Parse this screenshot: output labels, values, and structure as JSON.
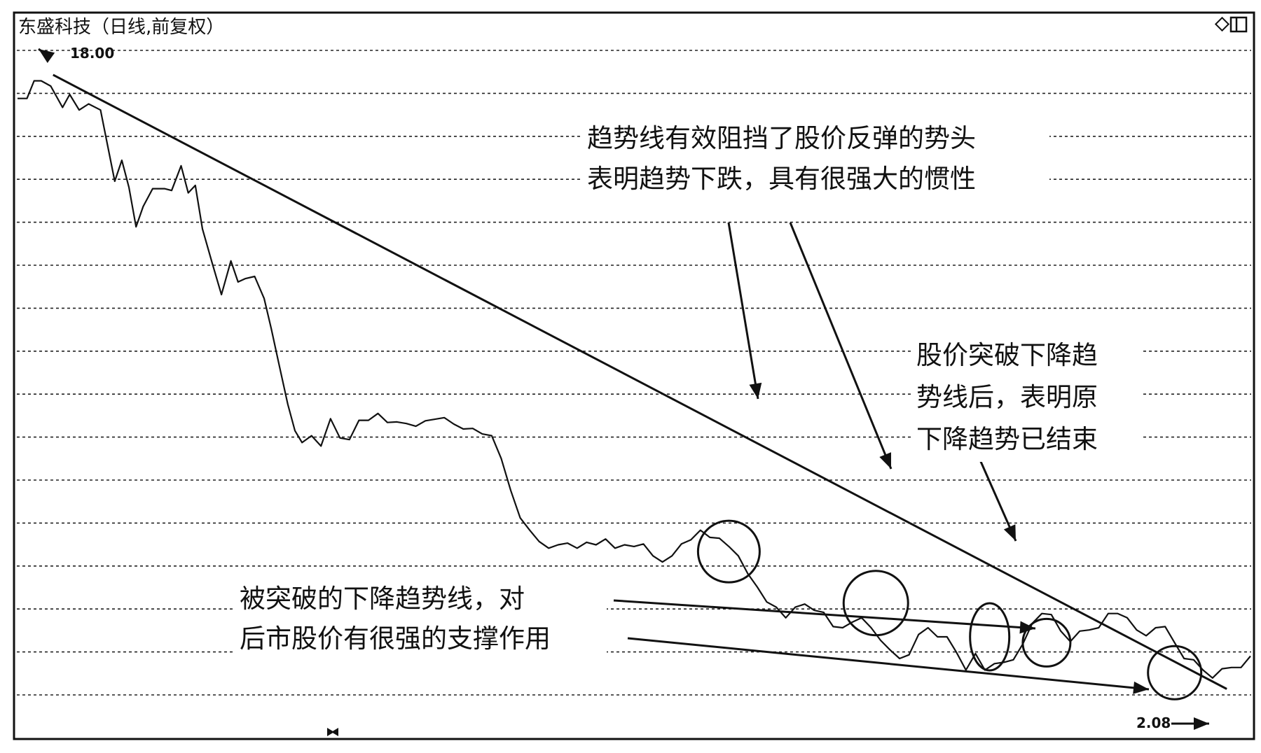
{
  "chart_data": {
    "type": "line",
    "title": "东盛科技（日线,前复权）",
    "price_high_label": "18.00",
    "price_low_label": "2.08",
    "toolbar_icons": [
      "diamond-icon",
      "panel-icon"
    ],
    "grid": true,
    "y_scale": "log",
    "ylim": [
      1.9,
      20.5
    ],
    "series": [
      {
        "x": [
          0,
          4,
          7,
          10,
          14,
          19,
          22,
          26,
          30,
          35,
          38,
          41,
          44,
          47,
          50,
          53,
          57,
          62,
          65,
          69,
          72,
          75,
          78,
          82,
          86,
          90,
          93,
          96,
          100,
          104,
          107,
          110,
          114,
          117,
          120,
          124,
          128,
          132,
          136,
          140,
          144,
          148,
          152,
          156,
          160,
          164,
          168,
          172,
          176,
          180,
          184,
          188,
          192,
          196,
          200,
          204,
          208,
          212,
          216,
          220,
          224,
          228,
          232,
          236,
          240,
          244,
          248,
          252,
          256,
          260,
          264,
          268,
          272,
          276,
          280,
          284,
          288,
          292,
          296,
          300,
          304,
          308,
          312,
          316,
          320,
          324,
          328,
          332,
          336,
          340,
          344,
          348,
          352,
          356,
          360,
          364,
          368,
          372,
          376,
          380,
          384,
          388,
          392,
          396,
          400,
          404,
          408,
          412,
          416,
          420,
          424,
          428,
          432,
          436,
          440,
          444,
          448,
          452,
          456,
          460,
          464,
          468,
          472,
          476,
          480,
          484,
          488,
          492,
          496,
          500,
          504,
          508,
          512,
          516,
          520
        ],
        "values": [
          16.54,
          16.54,
          17.62,
          17.62,
          17.29,
          16.02,
          16.78,
          15.87,
          16.22,
          15.87,
          13.98,
          12.3,
          13.26,
          12.03,
          10.45,
          11.24,
          11.98,
          11.98,
          11.9,
          13.0,
          11.8,
          12.12,
          10.37,
          9.21,
          8.2,
          9.25,
          8.58,
          8.68,
          8.75,
          8.09,
          7.26,
          6.46,
          5.54,
          5.04,
          4.83,
          4.95,
          4.77,
          5.26,
          4.91,
          4.88,
          5.23,
          5.23,
          5.36,
          5.19,
          5.2,
          5.17,
          5.12,
          5.22,
          5.25,
          5.28,
          5.16,
          5.07,
          5.08,
          4.98,
          4.95,
          4.56,
          4.07,
          3.69,
          3.53,
          3.39,
          3.31,
          3.35,
          3.37,
          3.31,
          3.38,
          3.35,
          3.42,
          3.31,
          3.35,
          3.33,
          3.36,
          3.22,
          3.15,
          3.22,
          3.36,
          3.41,
          3.53,
          3.44,
          3.43,
          3.33,
          3.22,
          3.02,
          2.88,
          2.73,
          2.68,
          2.58,
          2.68,
          2.71,
          2.65,
          2.63,
          2.5,
          2.49,
          2.54,
          2.58,
          2.49,
          2.38,
          2.3,
          2.23,
          2.26,
          2.43,
          2.49,
          2.41,
          2.41,
          2.28,
          2.14,
          2.27,
          2.14,
          2.19,
          2.2,
          2.22,
          2.35,
          2.53,
          2.62,
          2.61,
          2.46,
          2.37,
          2.46,
          2.47,
          2.49,
          2.62,
          2.62,
          2.58,
          2.47,
          2.42,
          2.49,
          2.5,
          2.36,
          2.23,
          2.22,
          2.14,
          2.08,
          2.15,
          2.16,
          2.16,
          2.25
        ]
      }
    ],
    "trendline": {
      "from": {
        "x": 15,
        "y": 18.0
      },
      "to": {
        "x": 510,
        "y": 2.0
      }
    },
    "highlight_circles": [
      {
        "x": 300,
        "y": 3.27
      },
      {
        "x": 362,
        "y": 2.72
      },
      {
        "x": 410,
        "y": 2.41
      },
      {
        "x": 434,
        "y": 2.36
      },
      {
        "x": 488,
        "y": 2.12
      }
    ],
    "annotations": [
      {
        "id": "resistance",
        "lines": [
          "趋势线有效阻挡了股价反弹的势头",
          "表明趋势下跌，具有很强大的惯性"
        ]
      },
      {
        "id": "breakout",
        "lines": [
          "股价突破下降趋",
          "势线后，表明原",
          "下降趋势已结束"
        ]
      },
      {
        "id": "support",
        "lines": [
          "被突破的下降趋势线，对",
          "后市股价有很强的支撑作用"
        ]
      }
    ]
  }
}
